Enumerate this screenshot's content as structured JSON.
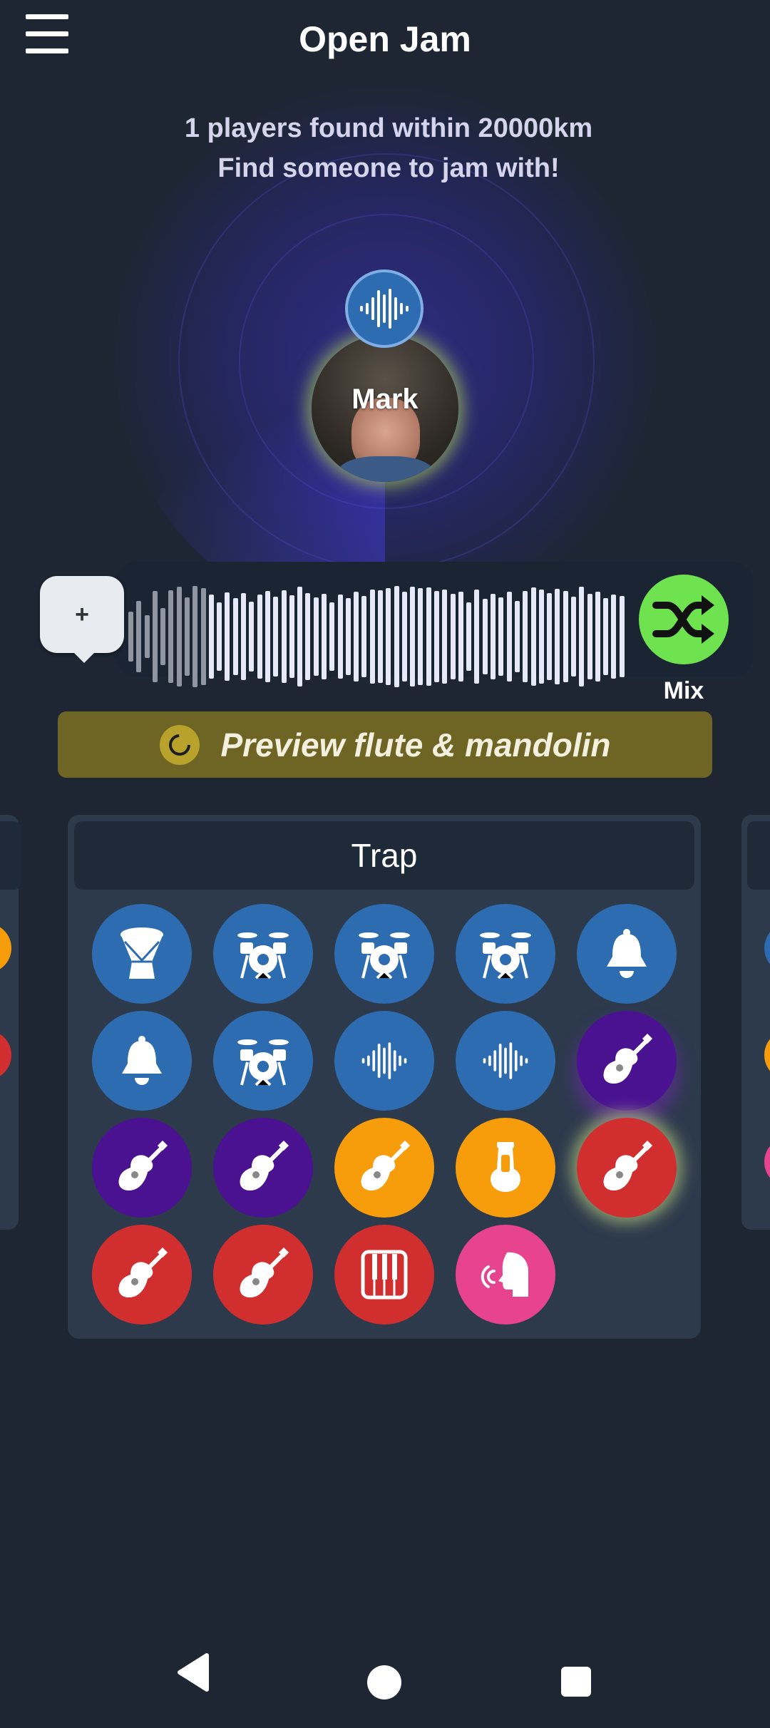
{
  "header": {
    "title": "Open Jam",
    "menu_icon": "hamburger-menu-icon"
  },
  "radar": {
    "found_line1": "1 players found within 20000km",
    "found_line2": "Find someone to jam with!"
  },
  "player": {
    "name": "Mark",
    "badge_icon": "waveform-icon"
  },
  "waveform": {
    "add_label": "+",
    "playback_progress": 0.15
  },
  "mix": {
    "label": "Mix",
    "icon": "shuffle-icon"
  },
  "preview": {
    "label": "Preview flute & mandolin",
    "icon": "loading-icon"
  },
  "kit": {
    "title": "Trap",
    "instruments": [
      {
        "icon": "djembe-icon",
        "color": "#2d6cb0"
      },
      {
        "icon": "drum-kit-icon",
        "color": "#2d6cb0"
      },
      {
        "icon": "drum-kit-icon",
        "color": "#2d6cb0"
      },
      {
        "icon": "drum-kit-icon",
        "color": "#2d6cb0"
      },
      {
        "icon": "bell-icon",
        "color": "#2d6cb0"
      },
      {
        "icon": "bell-icon",
        "color": "#2d6cb0"
      },
      {
        "icon": "drum-kit-icon",
        "color": "#2d6cb0"
      },
      {
        "icon": "waveform-icon",
        "color": "#2d6cb0"
      },
      {
        "icon": "waveform-icon",
        "color": "#2d6cb0"
      },
      {
        "icon": "guitar-icon",
        "color": "#4a1290"
      },
      {
        "icon": "guitar-icon",
        "color": "#4a1290"
      },
      {
        "icon": "guitar-icon",
        "color": "#4a1290"
      },
      {
        "icon": "guitar-icon",
        "color": "#f79c0a"
      },
      {
        "icon": "tuba-icon",
        "color": "#f79c0a"
      },
      {
        "icon": "guitar-icon",
        "color": "#d12f2f",
        "selected": true
      },
      {
        "icon": "guitar-icon",
        "color": "#d12f2f"
      },
      {
        "icon": "guitar-icon",
        "color": "#d12f2f"
      },
      {
        "icon": "piano-icon",
        "color": "#d12f2f"
      },
      {
        "icon": "voice-icon",
        "color": "#e7438f"
      }
    ]
  },
  "navbar": {
    "back": "back-icon",
    "home": "home-icon",
    "recents": "recents-icon"
  }
}
